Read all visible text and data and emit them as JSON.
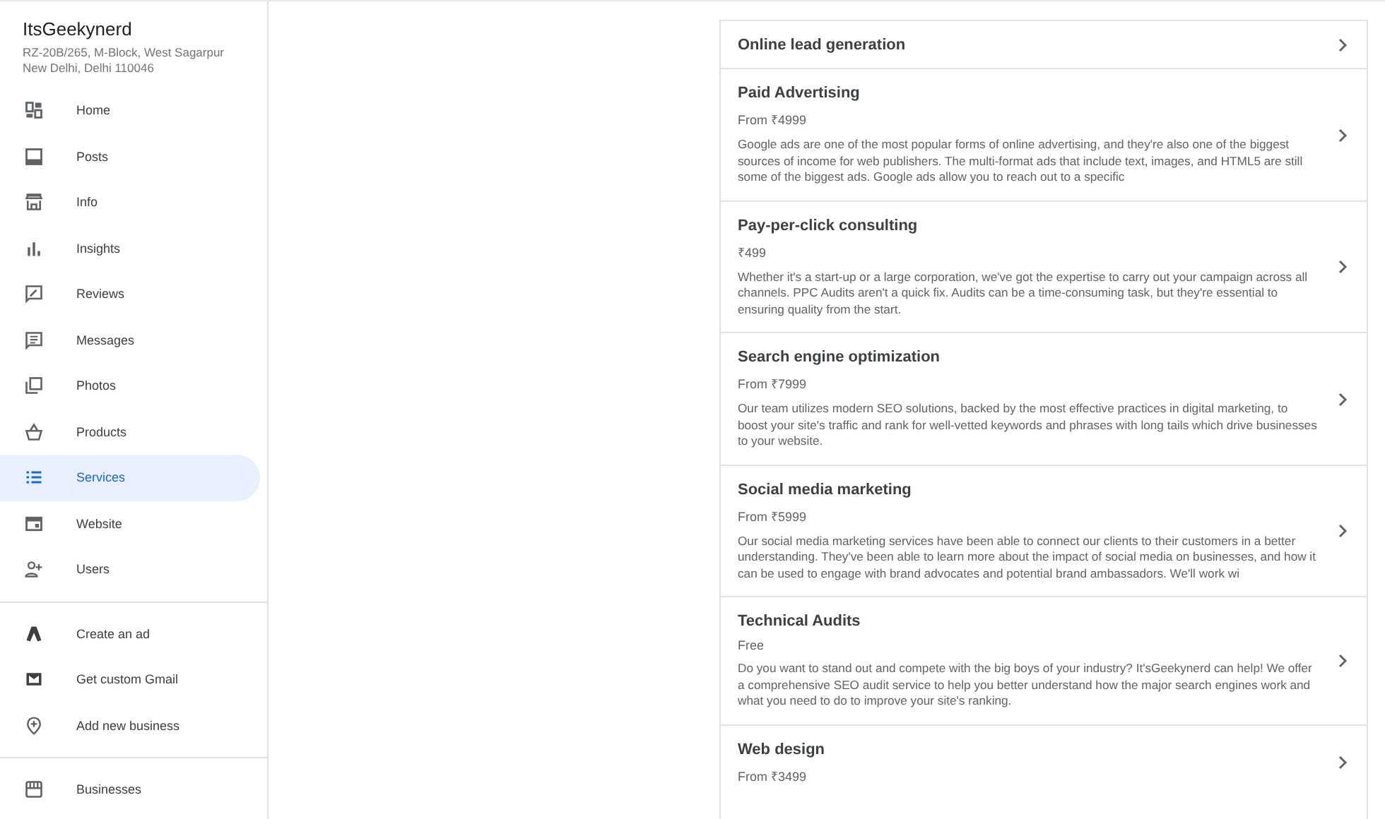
{
  "business": {
    "name": "ItsGeekynerd",
    "address_lines": [
      "RZ-20B/265, M-Block, West Sagarpur",
      "New Delhi, Delhi 110046"
    ]
  },
  "sidebar": {
    "sections": [
      [
        {
          "label": "Home",
          "selected": false
        },
        {
          "label": "Posts",
          "selected": false
        },
        {
          "label": "Info",
          "selected": false
        },
        {
          "label": "Insights",
          "selected": false
        },
        {
          "label": "Reviews",
          "selected": false
        },
        {
          "label": "Messages",
          "selected": false
        },
        {
          "label": "Photos",
          "selected": false
        },
        {
          "label": "Products",
          "selected": false
        },
        {
          "label": "Services",
          "selected": true
        },
        {
          "label": "Website",
          "selected": false
        },
        {
          "label": "Users",
          "selected": false
        }
      ],
      [
        {
          "label": "Create an ad",
          "selected": false
        },
        {
          "label": "Get custom Gmail",
          "selected": false
        },
        {
          "label": "Add new business",
          "selected": false
        }
      ],
      [
        {
          "label": "Businesses",
          "selected": false
        }
      ]
    ]
  },
  "services": [
    {
      "name": "Online lead generation"
    },
    {
      "name": "Paid Advertising",
      "price": "From ₹4999",
      "description": "Google ads are one of the most popular forms of online advertising, and they're also one of the biggest sources of income for web publishers. The multi-format ads that include text, images, and HTML5 are still some of the biggest ads. Google ads allow you to reach out to a specific"
    },
    {
      "name": "Pay-per-click consulting",
      "price": "₹499",
      "description": "Whether it's a start-up or a large corporation, we've got the expertise to carry out your campaign across all channels. PPC Audits aren't a quick fix. Audits can be a time-consuming task, but they're essential to ensuring quality from the start."
    },
    {
      "name": "Search engine optimization",
      "price": "From ₹7999",
      "description": "Our team utilizes modern SEO solutions, backed by the most effective practices in digital marketing, to boost your site's traffic and rank for well-vetted keywords and phrases with long tails which drive businesses to your website."
    },
    {
      "name": "Social media marketing",
      "price": "From ₹5999",
      "description": "Our social media marketing services have been able to connect our clients to their customers in a better understanding. They've been able to learn more about the impact of social media on businesses, and how it can be used to engage with brand advocates and potential brand ambassadors. We'll work wi"
    },
    {
      "name": "Technical Audits",
      "price": "Free",
      "description": "Do you want to stand out and compete with the big boys of your industry? It'sGeekynerd can help! We offer a comprehensive SEO audit service to help you better understand how the major search engines work and what you need to do to improve your site's ranking."
    },
    {
      "name": "Web design",
      "price": "From ₹3499"
    }
  ]
}
